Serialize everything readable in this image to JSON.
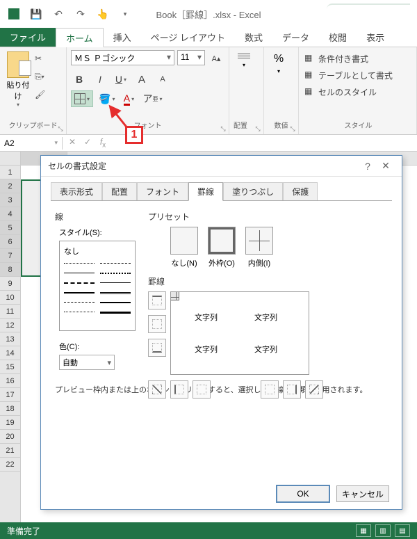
{
  "titlebar": {
    "title": "Book［罫線］.xlsx - Excel"
  },
  "tabs": {
    "file": "ファイル",
    "home": "ホーム",
    "insert": "挿入",
    "pagelayout": "ページ レイアウト",
    "formulas": "数式",
    "data": "データ",
    "review": "校閲",
    "view": "表示"
  },
  "ribbon": {
    "clipboard": {
      "paste": "貼り付け",
      "group": "クリップボード"
    },
    "font": {
      "name": "ＭＳ Ｐゴシック",
      "size": "11",
      "group": "フォント"
    },
    "align": {
      "group": "配置"
    },
    "number": {
      "group": "数値"
    },
    "styles": {
      "conditional": "条件付き書式",
      "table": "テーブルとして書式",
      "cell": "セルのスタイル",
      "group": "スタイル"
    }
  },
  "namebox": "A2",
  "statusbar": {
    "ready": "準備完了"
  },
  "dialog": {
    "title": "セルの書式設定",
    "tabs": {
      "number": "表示形式",
      "alignment": "配置",
      "font": "フォント",
      "border": "罫線",
      "fill": "塗りつぶし",
      "protection": "保護"
    },
    "line_section": "線",
    "style_label": "スタイル(S):",
    "style_none": "なし",
    "color_label": "色(C):",
    "color_auto": "自動",
    "preset_section": "プリセット",
    "presets": {
      "none": "なし(N)",
      "outline": "外枠(O)",
      "inside": "内側(I)"
    },
    "border_section": "罫線",
    "preview_text": "文字列",
    "hint": "プレビュー枠内または上のボタンをクリックすると、選択した罫線の種類が適用されます。",
    "ok": "OK",
    "cancel": "キャンセル"
  },
  "annotation": {
    "label": "1"
  }
}
